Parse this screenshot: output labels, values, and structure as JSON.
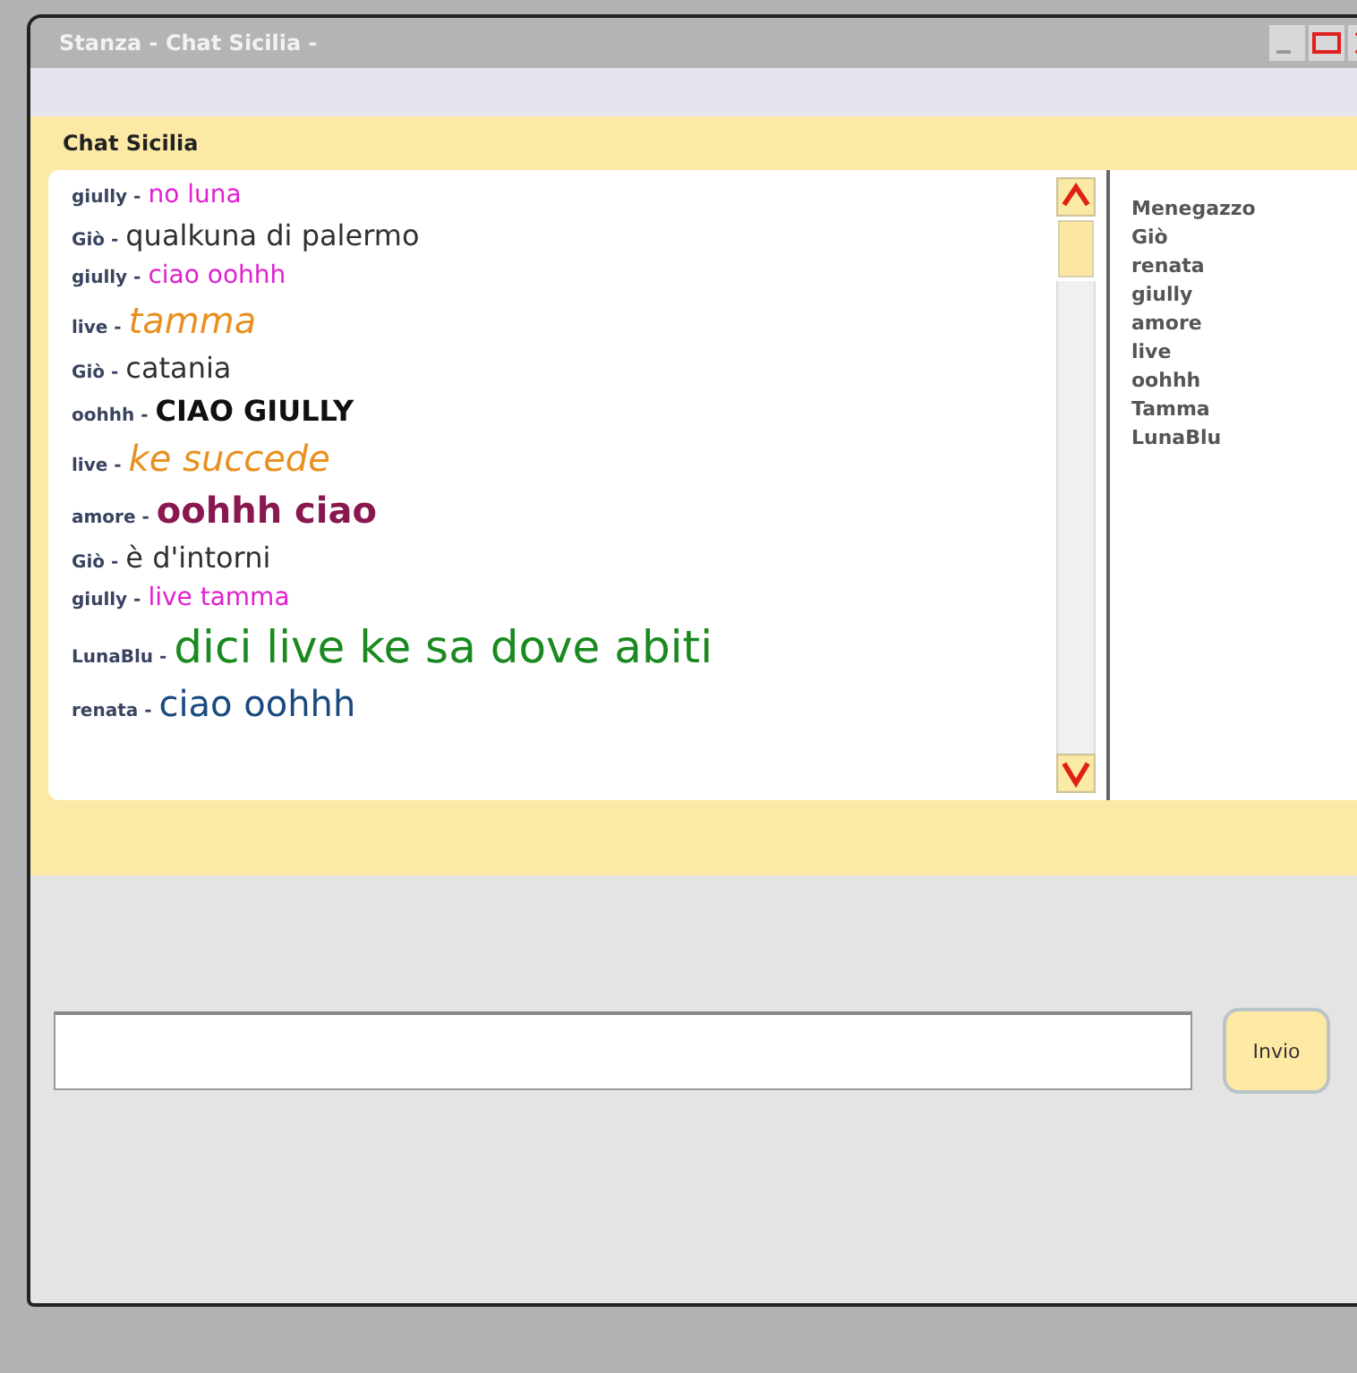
{
  "window": {
    "title": "Stanza - Chat Sicilia -"
  },
  "room": {
    "title": "Chat Sicilia"
  },
  "messages": [
    {
      "user": "giully",
      "separator": "-",
      "text": "no luna",
      "color": "#e020d0",
      "kind": "small"
    },
    {
      "user": "Giò",
      "separator": "-",
      "text": "qualkuna di palermo",
      "color": "#303030",
      "kind": "plain"
    },
    {
      "user": "giully",
      "separator": "-",
      "text": "ciao oohhh",
      "color": "#e020d0",
      "kind": "small"
    },
    {
      "user": "live",
      "separator": "-",
      "text": "tamma",
      "color": "#e89020",
      "kind": "script"
    },
    {
      "user": "Giò",
      "separator": "-",
      "text": "catania",
      "color": "#303030",
      "kind": "plain"
    },
    {
      "user": "oohhh",
      "separator": "-",
      "text": "CIAO GIULLY",
      "color": "#101010",
      "kind": "bold"
    },
    {
      "user": "live",
      "separator": "-",
      "text": "ke succede",
      "color": "#e89020",
      "kind": "script"
    },
    {
      "user": "amore",
      "separator": "-",
      "text": "oohhh ciao",
      "color": "#8a1850",
      "kind": "heavy"
    },
    {
      "user": "Giò",
      "separator": "-",
      "text": "è d'intorni",
      "color": "#303030",
      "kind": "plain"
    },
    {
      "user": "giully",
      "separator": "-",
      "text": "live tamma",
      "color": "#e020d0",
      "kind": "small"
    },
    {
      "user": "LunaBlu",
      "separator": "-",
      "text": "dici live ke sa dove abiti",
      "color": "#1a8a20",
      "kind": "huge"
    },
    {
      "user": "renata",
      "separator": "-",
      "text": "ciao oohhh",
      "color": "#1a4a80",
      "kind": "large"
    }
  ],
  "users": [
    "Menegazzo",
    "Giò",
    "renata",
    "giully",
    "amore",
    "live",
    "oohhh",
    "Tamma",
    "LunaBlu"
  ],
  "send_button": {
    "label": "Invio"
  }
}
